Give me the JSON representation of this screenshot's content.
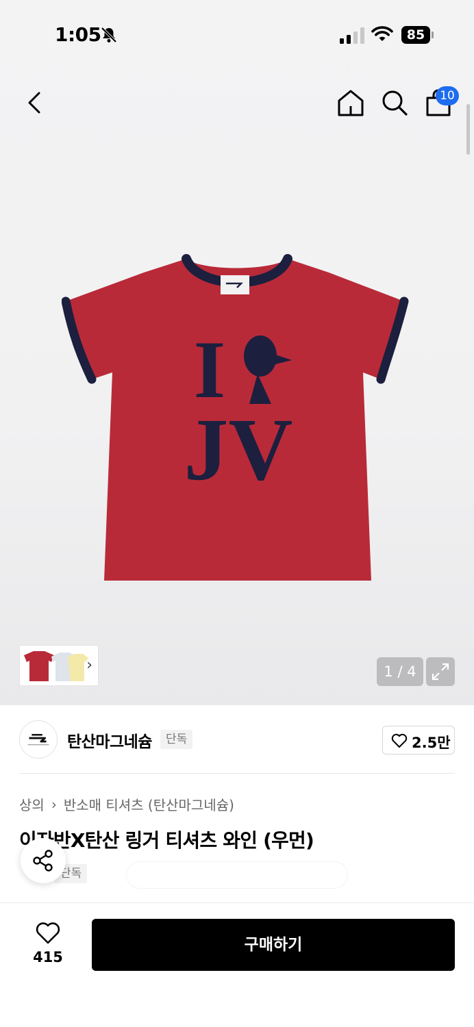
{
  "status_bar": {
    "time": "1:05",
    "battery": "85"
  },
  "header": {
    "cart_count": "10"
  },
  "product_image": {
    "print_line1": "I",
    "print_line2": "JV",
    "image_index": "1 / 4"
  },
  "brand": {
    "name": "탄산마그네슘",
    "exclusive_label": "단독",
    "likes": "2.5만"
  },
  "breadcrumb": {
    "category": "상의",
    "separator": "›",
    "subcategory": "반소매 티셔츠 (탄산마그네슘)"
  },
  "product": {
    "title": "이자반X탄산 링거 티셔츠 와인 (우먼)",
    "tag": "단독"
  },
  "bottom_bar": {
    "like_count": "415",
    "buy_label": "구매하기"
  },
  "colors": {
    "accent": "#1e6cf0",
    "shirt_red": "#b92a39",
    "navy": "#1c1f3d"
  },
  "icons": [
    "bell-off-icon",
    "signal-icon",
    "wifi-icon",
    "back-icon",
    "home-icon",
    "search-icon",
    "cart-icon",
    "expand-icon",
    "heart-icon",
    "share-icon",
    "chevron-right-icon"
  ]
}
